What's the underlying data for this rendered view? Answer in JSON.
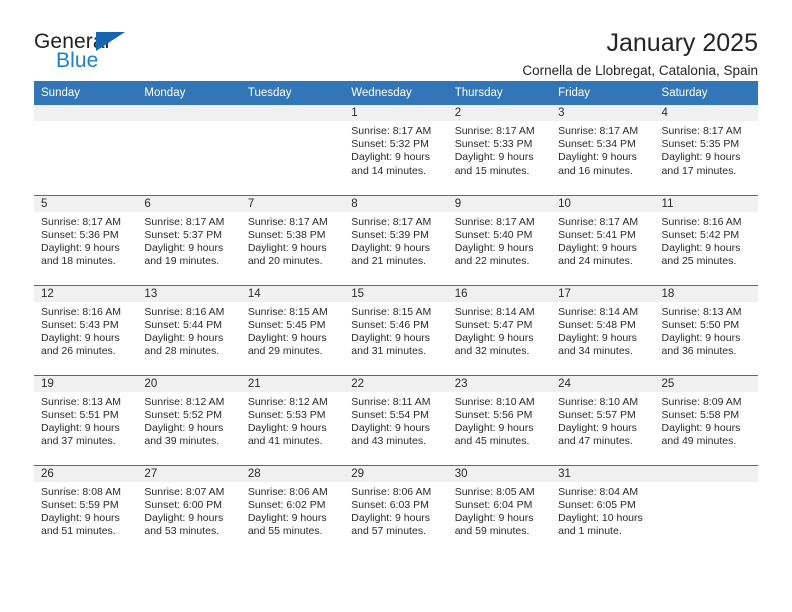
{
  "brand": {
    "name_part1": "General",
    "name_part2": "Blue",
    "triangle_icon": "triangle-icon",
    "accent_color": "#1565b0",
    "blue_text_color": "#1a7fd4"
  },
  "header": {
    "month_title": "January 2025",
    "location": "Cornella de Llobregat, Catalonia, Spain"
  },
  "calendar": {
    "header_bg_color": "#3276b8",
    "daynum_bg_color": "#f0f0f0",
    "weekdays": [
      "Sunday",
      "Monday",
      "Tuesday",
      "Wednesday",
      "Thursday",
      "Friday",
      "Saturday"
    ],
    "weeks": [
      [
        {
          "day": "",
          "sunrise": "",
          "sunset": "",
          "daylight_line1": "",
          "daylight_line2": "",
          "empty": true
        },
        {
          "day": "",
          "sunrise": "",
          "sunset": "",
          "daylight_line1": "",
          "daylight_line2": "",
          "empty": true
        },
        {
          "day": "",
          "sunrise": "",
          "sunset": "",
          "daylight_line1": "",
          "daylight_line2": "",
          "empty": true
        },
        {
          "day": "1",
          "sunrise": "Sunrise: 8:17 AM",
          "sunset": "Sunset: 5:32 PM",
          "daylight_line1": "Daylight: 9 hours",
          "daylight_line2": "and 14 minutes.",
          "empty": false
        },
        {
          "day": "2",
          "sunrise": "Sunrise: 8:17 AM",
          "sunset": "Sunset: 5:33 PM",
          "daylight_line1": "Daylight: 9 hours",
          "daylight_line2": "and 15 minutes.",
          "empty": false
        },
        {
          "day": "3",
          "sunrise": "Sunrise: 8:17 AM",
          "sunset": "Sunset: 5:34 PM",
          "daylight_line1": "Daylight: 9 hours",
          "daylight_line2": "and 16 minutes.",
          "empty": false
        },
        {
          "day": "4",
          "sunrise": "Sunrise: 8:17 AM",
          "sunset": "Sunset: 5:35 PM",
          "daylight_line1": "Daylight: 9 hours",
          "daylight_line2": "and 17 minutes.",
          "empty": false
        }
      ],
      [
        {
          "day": "5",
          "sunrise": "Sunrise: 8:17 AM",
          "sunset": "Sunset: 5:36 PM",
          "daylight_line1": "Daylight: 9 hours",
          "daylight_line2": "and 18 minutes.",
          "empty": false
        },
        {
          "day": "6",
          "sunrise": "Sunrise: 8:17 AM",
          "sunset": "Sunset: 5:37 PM",
          "daylight_line1": "Daylight: 9 hours",
          "daylight_line2": "and 19 minutes.",
          "empty": false
        },
        {
          "day": "7",
          "sunrise": "Sunrise: 8:17 AM",
          "sunset": "Sunset: 5:38 PM",
          "daylight_line1": "Daylight: 9 hours",
          "daylight_line2": "and 20 minutes.",
          "empty": false
        },
        {
          "day": "8",
          "sunrise": "Sunrise: 8:17 AM",
          "sunset": "Sunset: 5:39 PM",
          "daylight_line1": "Daylight: 9 hours",
          "daylight_line2": "and 21 minutes.",
          "empty": false
        },
        {
          "day": "9",
          "sunrise": "Sunrise: 8:17 AM",
          "sunset": "Sunset: 5:40 PM",
          "daylight_line1": "Daylight: 9 hours",
          "daylight_line2": "and 22 minutes.",
          "empty": false
        },
        {
          "day": "10",
          "sunrise": "Sunrise: 8:17 AM",
          "sunset": "Sunset: 5:41 PM",
          "daylight_line1": "Daylight: 9 hours",
          "daylight_line2": "and 24 minutes.",
          "empty": false
        },
        {
          "day": "11",
          "sunrise": "Sunrise: 8:16 AM",
          "sunset": "Sunset: 5:42 PM",
          "daylight_line1": "Daylight: 9 hours",
          "daylight_line2": "and 25 minutes.",
          "empty": false
        }
      ],
      [
        {
          "day": "12",
          "sunrise": "Sunrise: 8:16 AM",
          "sunset": "Sunset: 5:43 PM",
          "daylight_line1": "Daylight: 9 hours",
          "daylight_line2": "and 26 minutes.",
          "empty": false
        },
        {
          "day": "13",
          "sunrise": "Sunrise: 8:16 AM",
          "sunset": "Sunset: 5:44 PM",
          "daylight_line1": "Daylight: 9 hours",
          "daylight_line2": "and 28 minutes.",
          "empty": false
        },
        {
          "day": "14",
          "sunrise": "Sunrise: 8:15 AM",
          "sunset": "Sunset: 5:45 PM",
          "daylight_line1": "Daylight: 9 hours",
          "daylight_line2": "and 29 minutes.",
          "empty": false
        },
        {
          "day": "15",
          "sunrise": "Sunrise: 8:15 AM",
          "sunset": "Sunset: 5:46 PM",
          "daylight_line1": "Daylight: 9 hours",
          "daylight_line2": "and 31 minutes.",
          "empty": false
        },
        {
          "day": "16",
          "sunrise": "Sunrise: 8:14 AM",
          "sunset": "Sunset: 5:47 PM",
          "daylight_line1": "Daylight: 9 hours",
          "daylight_line2": "and 32 minutes.",
          "empty": false
        },
        {
          "day": "17",
          "sunrise": "Sunrise: 8:14 AM",
          "sunset": "Sunset: 5:48 PM",
          "daylight_line1": "Daylight: 9 hours",
          "daylight_line2": "and 34 minutes.",
          "empty": false
        },
        {
          "day": "18",
          "sunrise": "Sunrise: 8:13 AM",
          "sunset": "Sunset: 5:50 PM",
          "daylight_line1": "Daylight: 9 hours",
          "daylight_line2": "and 36 minutes.",
          "empty": false
        }
      ],
      [
        {
          "day": "19",
          "sunrise": "Sunrise: 8:13 AM",
          "sunset": "Sunset: 5:51 PM",
          "daylight_line1": "Daylight: 9 hours",
          "daylight_line2": "and 37 minutes.",
          "empty": false
        },
        {
          "day": "20",
          "sunrise": "Sunrise: 8:12 AM",
          "sunset": "Sunset: 5:52 PM",
          "daylight_line1": "Daylight: 9 hours",
          "daylight_line2": "and 39 minutes.",
          "empty": false
        },
        {
          "day": "21",
          "sunrise": "Sunrise: 8:12 AM",
          "sunset": "Sunset: 5:53 PM",
          "daylight_line1": "Daylight: 9 hours",
          "daylight_line2": "and 41 minutes.",
          "empty": false
        },
        {
          "day": "22",
          "sunrise": "Sunrise: 8:11 AM",
          "sunset": "Sunset: 5:54 PM",
          "daylight_line1": "Daylight: 9 hours",
          "daylight_line2": "and 43 minutes.",
          "empty": false
        },
        {
          "day": "23",
          "sunrise": "Sunrise: 8:10 AM",
          "sunset": "Sunset: 5:56 PM",
          "daylight_line1": "Daylight: 9 hours",
          "daylight_line2": "and 45 minutes.",
          "empty": false
        },
        {
          "day": "24",
          "sunrise": "Sunrise: 8:10 AM",
          "sunset": "Sunset: 5:57 PM",
          "daylight_line1": "Daylight: 9 hours",
          "daylight_line2": "and 47 minutes.",
          "empty": false
        },
        {
          "day": "25",
          "sunrise": "Sunrise: 8:09 AM",
          "sunset": "Sunset: 5:58 PM",
          "daylight_line1": "Daylight: 9 hours",
          "daylight_line2": "and 49 minutes.",
          "empty": false
        }
      ],
      [
        {
          "day": "26",
          "sunrise": "Sunrise: 8:08 AM",
          "sunset": "Sunset: 5:59 PM",
          "daylight_line1": "Daylight: 9 hours",
          "daylight_line2": "and 51 minutes.",
          "empty": false
        },
        {
          "day": "27",
          "sunrise": "Sunrise: 8:07 AM",
          "sunset": "Sunset: 6:00 PM",
          "daylight_line1": "Daylight: 9 hours",
          "daylight_line2": "and 53 minutes.",
          "empty": false
        },
        {
          "day": "28",
          "sunrise": "Sunrise: 8:06 AM",
          "sunset": "Sunset: 6:02 PM",
          "daylight_line1": "Daylight: 9 hours",
          "daylight_line2": "and 55 minutes.",
          "empty": false
        },
        {
          "day": "29",
          "sunrise": "Sunrise: 8:06 AM",
          "sunset": "Sunset: 6:03 PM",
          "daylight_line1": "Daylight: 9 hours",
          "daylight_line2": "and 57 minutes.",
          "empty": false
        },
        {
          "day": "30",
          "sunrise": "Sunrise: 8:05 AM",
          "sunset": "Sunset: 6:04 PM",
          "daylight_line1": "Daylight: 9 hours",
          "daylight_line2": "and 59 minutes.",
          "empty": false
        },
        {
          "day": "31",
          "sunrise": "Sunrise: 8:04 AM",
          "sunset": "Sunset: 6:05 PM",
          "daylight_line1": "Daylight: 10 hours",
          "daylight_line2": "and 1 minute.",
          "empty": false
        },
        {
          "day": "",
          "sunrise": "",
          "sunset": "",
          "daylight_line1": "",
          "daylight_line2": "",
          "empty": true
        }
      ]
    ]
  }
}
